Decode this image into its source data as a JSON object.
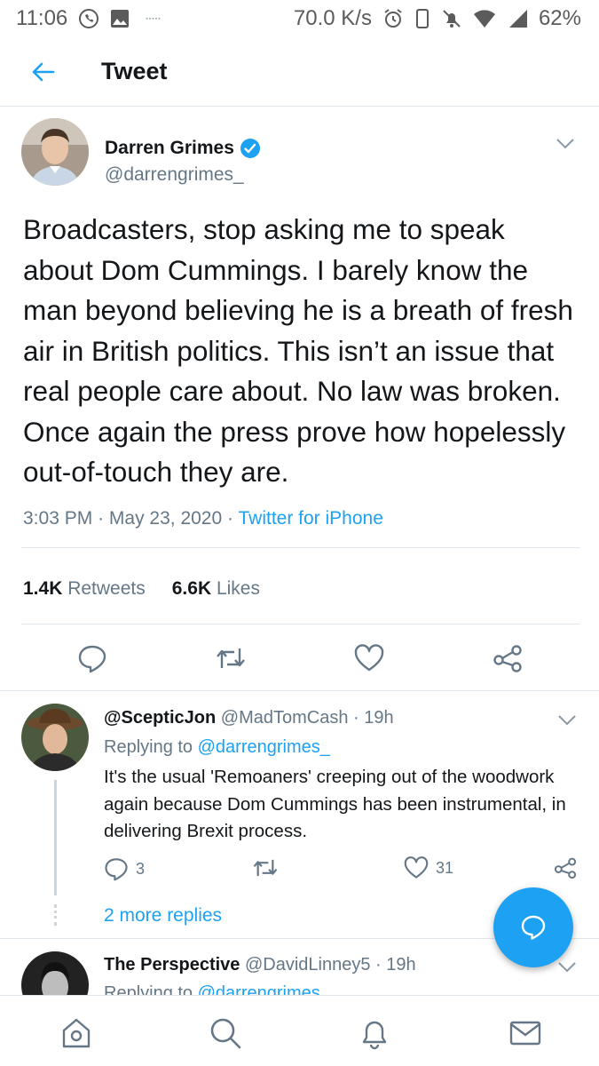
{
  "status_bar": {
    "time": "11:06",
    "net_speed": "70.0 K/s",
    "battery": "62%",
    "left_icons": [
      "whatsapp-icon",
      "gallery-icon"
    ],
    "right_icons": [
      "alarm-icon",
      "vibrate-icon",
      "mute-icon",
      "wifi-icon",
      "signal-icon"
    ]
  },
  "header": {
    "title": "Tweet",
    "back_icon": "arrow-left-icon"
  },
  "tweet": {
    "author_name": "Darren Grimes",
    "verified": true,
    "handle": "@darrengrimes_",
    "text": "Broadcasters, stop asking me to speak about Dom Cummings. I barely know the man beyond believing he is a breath of fresh air in British politics. This isn’t an issue that real people care about. No law was broken. Once again the press prove how hopelessly out-of-touch they are.",
    "time": "3:03 PM",
    "date": "May 23, 2020",
    "separator": "·",
    "source": "Twitter for iPhone",
    "retweets_count": "1.4K",
    "retweets_label": "Retweets",
    "likes_count": "6.6K",
    "likes_label": "Likes"
  },
  "replies": [
    {
      "name": "@ScepticJon",
      "handle": "@MadTomCash",
      "time": "19h",
      "replying_label": "Replying to",
      "replying_to": "@darrengrimes_",
      "text": "It's the usual 'Remoaners' creeping out of the woodwork again because Dom Cummings has been instrumental, in delivering Brexit process.",
      "reply_count": "3",
      "like_count": "31",
      "more_replies": "2 more replies"
    },
    {
      "name": "The Perspective",
      "handle": "@DavidLinney5",
      "time": "19h",
      "replying_label": "Replying to",
      "replying_to": "@darrengrimes_"
    }
  ],
  "colors": {
    "accent": "#1da1f2",
    "text": "#14171a",
    "muted": "#657786",
    "divider": "#e1e8ed"
  },
  "bottom_nav": [
    "home-icon",
    "search-icon",
    "notifications-icon",
    "messages-icon"
  ]
}
